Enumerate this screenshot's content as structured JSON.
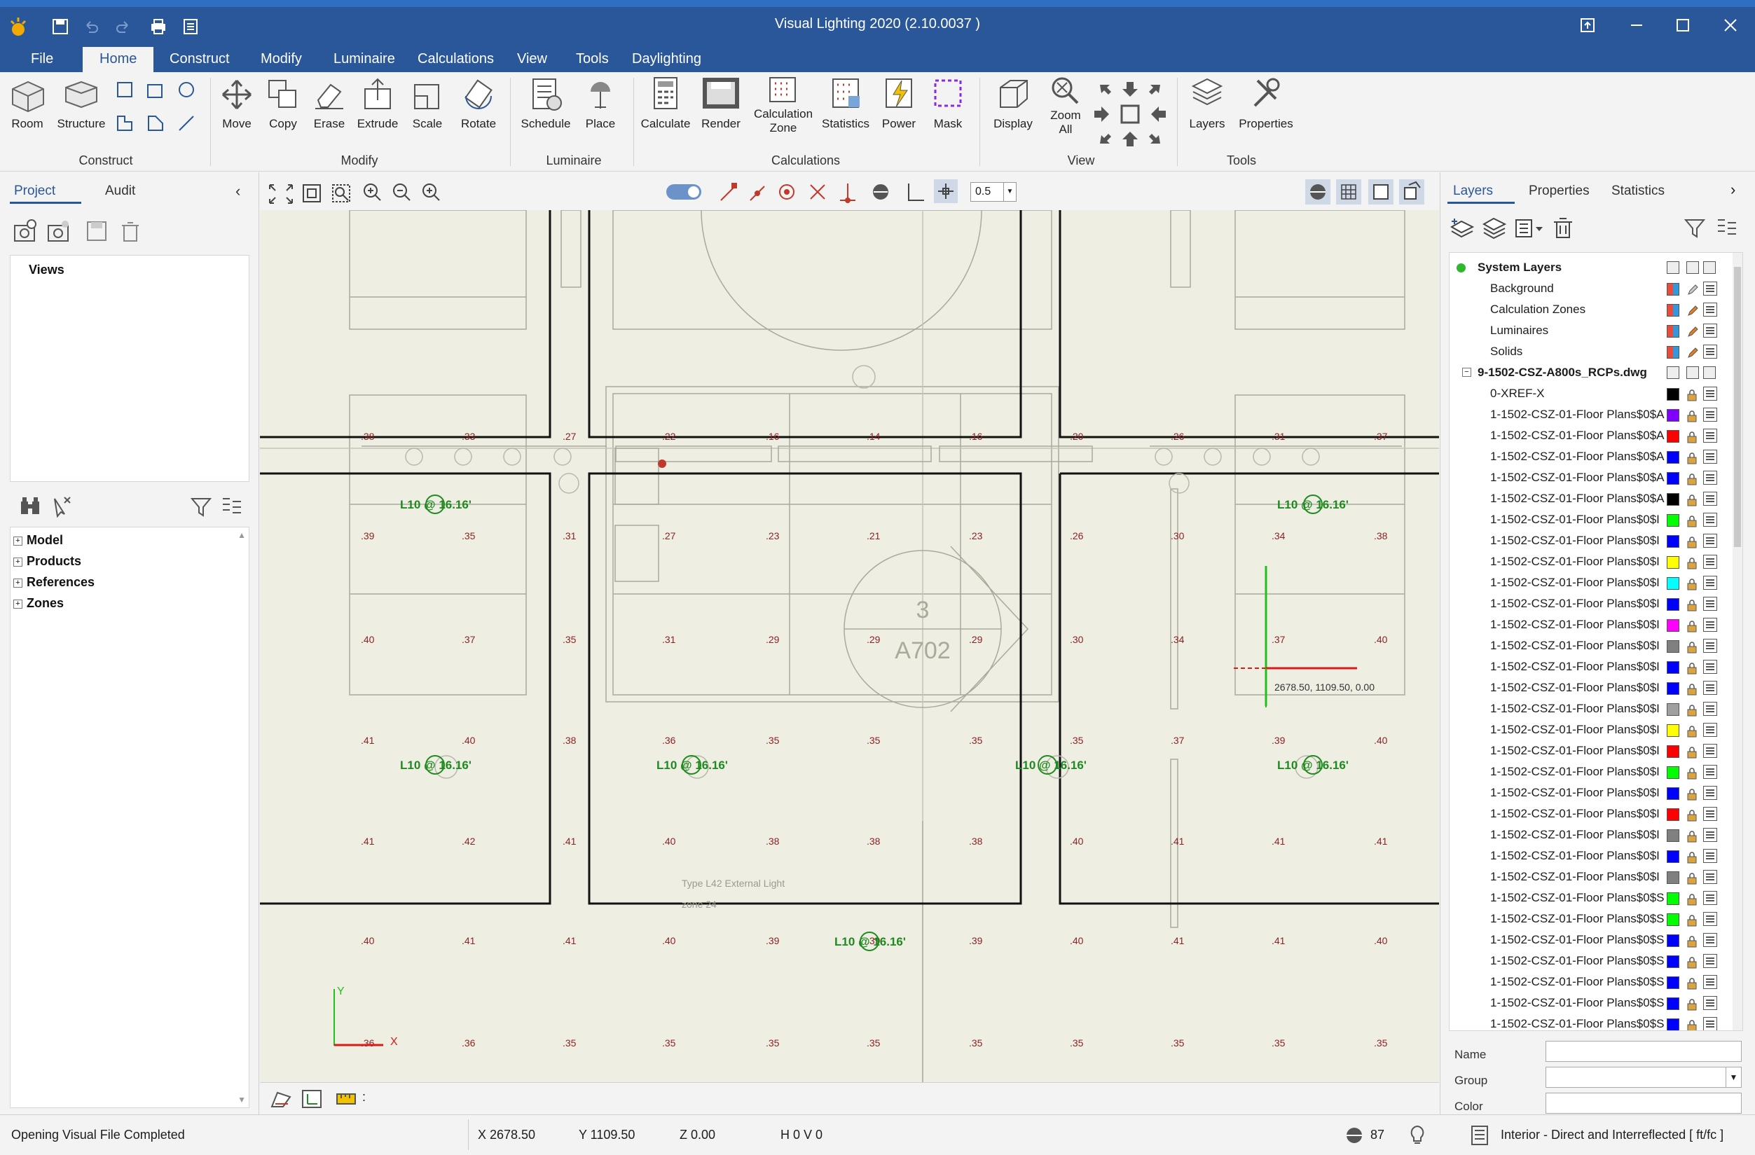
{
  "app": {
    "title": "Visual Lighting 2020 (2.10.0037 )"
  },
  "menu": [
    "File",
    "Home",
    "Construct",
    "Modify",
    "Luminaire",
    "Calculations",
    "View",
    "Tools",
    "Daylighting"
  ],
  "ribbon": {
    "construct": {
      "room": "Room",
      "structure": "Structure",
      "group": "Construct"
    },
    "modify": {
      "move": "Move",
      "copy": "Copy",
      "erase": "Erase",
      "extrude": "Extrude",
      "scale": "Scale",
      "rotate": "Rotate",
      "group": "Modify"
    },
    "luminaire": {
      "schedule": "Schedule",
      "place": "Place",
      "group": "Luminaire"
    },
    "calculations": {
      "calculate": "Calculate",
      "render": "Render",
      "calc_zone_1": "Calculation",
      "calc_zone_2": "Zone",
      "statistics": "Statistics",
      "power": "Power",
      "mask": "Mask",
      "group": "Calculations"
    },
    "view": {
      "display": "Display",
      "zoom_1": "Zoom",
      "zoom_2": "All",
      "group": "View"
    },
    "tools": {
      "layers": "Layers",
      "properties": "Properties",
      "group": "Tools"
    }
  },
  "left": {
    "tab_project": "Project",
    "tab_audit": "Audit",
    "views_label": "Views",
    "tree": [
      "Model",
      "Products",
      "References",
      "Zones"
    ]
  },
  "canvas": {
    "snap_value": "0.5",
    "coord_label": "2678.50, 1109.50, 0.00",
    "room_number": "3",
    "sheet_ref": "A702",
    "type_note": "Type L42 External Light",
    "zone_note": "zone 24",
    "luminaire_label": "L10 @ 16.16'",
    "axis_x": "X",
    "axis_y": "Y",
    "bottom_sep": ":"
  },
  "right": {
    "tab_layers": "Layers",
    "tab_properties": "Properties",
    "tab_statistics": "Statistics",
    "system_layers": "System Layers",
    "system_children": [
      "Background",
      "Calculation Zones",
      "Luminaires",
      "Solids"
    ],
    "dwg": "9-1502-CSZ-A800s_RCPs.dwg",
    "xref": "0-XREF-X",
    "floor_layers": [
      {
        "name": "1-1502-CSZ-01-Floor Plans$0$A",
        "color": "#8000ff"
      },
      {
        "name": "1-1502-CSZ-01-Floor Plans$0$A",
        "color": "#ff0000"
      },
      {
        "name": "1-1502-CSZ-01-Floor Plans$0$A",
        "color": "#0000ff"
      },
      {
        "name": "1-1502-CSZ-01-Floor Plans$0$A",
        "color": "#0000ff"
      },
      {
        "name": "1-1502-CSZ-01-Floor Plans$0$A",
        "color": "#000000"
      },
      {
        "name": "1-1502-CSZ-01-Floor Plans$0$I",
        "color": "#00ff00"
      },
      {
        "name": "1-1502-CSZ-01-Floor Plans$0$I",
        "color": "#0000ff"
      },
      {
        "name": "1-1502-CSZ-01-Floor Plans$0$I",
        "color": "#ffff00"
      },
      {
        "name": "1-1502-CSZ-01-Floor Plans$0$I",
        "color": "#00ffff"
      },
      {
        "name": "1-1502-CSZ-01-Floor Plans$0$I",
        "color": "#0000ff"
      },
      {
        "name": "1-1502-CSZ-01-Floor Plans$0$I",
        "color": "#ff00ff"
      },
      {
        "name": "1-1502-CSZ-01-Floor Plans$0$I",
        "color": "#808080"
      },
      {
        "name": "1-1502-CSZ-01-Floor Plans$0$I",
        "color": "#0000ff"
      },
      {
        "name": "1-1502-CSZ-01-Floor Plans$0$I",
        "color": "#0000ff"
      },
      {
        "name": "1-1502-CSZ-01-Floor Plans$0$I",
        "color": "#a0a0a0"
      },
      {
        "name": "1-1502-CSZ-01-Floor Plans$0$I",
        "color": "#ffff00"
      },
      {
        "name": "1-1502-CSZ-01-Floor Plans$0$I",
        "color": "#ff0000"
      },
      {
        "name": "1-1502-CSZ-01-Floor Plans$0$I",
        "color": "#00ff00"
      },
      {
        "name": "1-1502-CSZ-01-Floor Plans$0$I",
        "color": "#0000ff"
      },
      {
        "name": "1-1502-CSZ-01-Floor Plans$0$I",
        "color": "#ff0000"
      },
      {
        "name": "1-1502-CSZ-01-Floor Plans$0$I",
        "color": "#808080"
      },
      {
        "name": "1-1502-CSZ-01-Floor Plans$0$I",
        "color": "#0000ff"
      },
      {
        "name": "1-1502-CSZ-01-Floor Plans$0$I",
        "color": "#808080"
      },
      {
        "name": "1-1502-CSZ-01-Floor Plans$0$S",
        "color": "#00ff00"
      },
      {
        "name": "1-1502-CSZ-01-Floor Plans$0$S",
        "color": "#00ff00"
      },
      {
        "name": "1-1502-CSZ-01-Floor Plans$0$S",
        "color": "#0000ff"
      },
      {
        "name": "1-1502-CSZ-01-Floor Plans$0$S",
        "color": "#0000ff"
      },
      {
        "name": "1-1502-CSZ-01-Floor Plans$0$S",
        "color": "#0000ff"
      },
      {
        "name": "1-1502-CSZ-01-Floor Plans$0$S",
        "color": "#0000ff"
      },
      {
        "name": "1-1502-CSZ-01-Floor Plans$0$S",
        "color": "#0000ff"
      }
    ],
    "prop_name": "Name",
    "prop_group": "Group",
    "prop_color": "Color"
  },
  "status": {
    "message": "Opening Visual File Completed",
    "x": "X  2678.50",
    "y": "Y  1109.50",
    "z": "Z  0.00",
    "hv": "H 0  V 0",
    "count": "87",
    "mode": "Interior - Direct and Interreflected [ ft/fc ]"
  }
}
